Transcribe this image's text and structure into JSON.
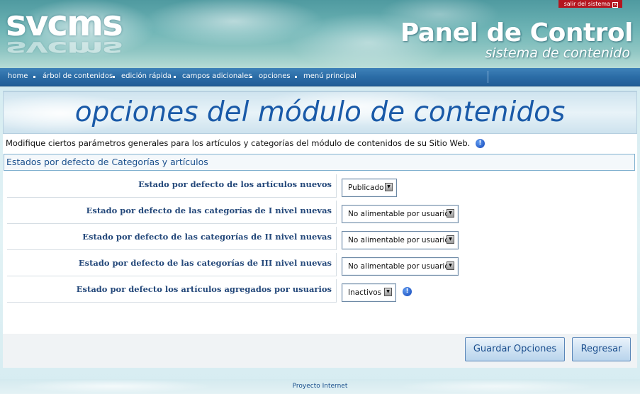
{
  "header": {
    "logo_text": "svcms",
    "panel_title": "Panel de Control",
    "panel_subtitle": "sistema de contenido",
    "logout_label": "salir del sistema"
  },
  "nav": {
    "items": [
      {
        "label": "home"
      },
      {
        "label": "árbol de contenidos"
      },
      {
        "label": "edición rápida"
      },
      {
        "label": "campos adicionales"
      },
      {
        "label": "opciones"
      },
      {
        "label": "menú principal"
      }
    ]
  },
  "page": {
    "title": "opciones del módulo de contenidos",
    "description": "Modifique ciertos parámetros generales para los artículos y categorías del módulo de contenidos de su Sitio Web."
  },
  "section": {
    "title": "Estados por defecto de Categorías y artículos",
    "rows": [
      {
        "label": "Estado por defecto de los artículos nuevos",
        "value": "Publicado"
      },
      {
        "label": "Estado por defecto de las categorías de I nivel nuevas",
        "value": "No alimentable por usuarios"
      },
      {
        "label": "Estado por defecto de las categorías de II nivel nuevas",
        "value": "No alimentable por usuarios"
      },
      {
        "label": "Estado  por defecto de las categorías de III nivel nuevas",
        "value": "No alimentable por usuarios"
      },
      {
        "label": "Estado  por defecto los artículos agregados por usuarios",
        "value": "Inactivos"
      }
    ]
  },
  "buttons": {
    "save": "Guardar Opciones",
    "back": "Regresar"
  },
  "footer": {
    "text": "Proyecto Internet"
  },
  "colors": {
    "nav_bg": "#2b6ca6",
    "title": "#1a5aa8",
    "label": "#24487a",
    "logout_bg": "#b4151f"
  },
  "icons": {
    "info": "info-icon",
    "close": "close-icon",
    "dropdown": "chevron-down-icon"
  }
}
